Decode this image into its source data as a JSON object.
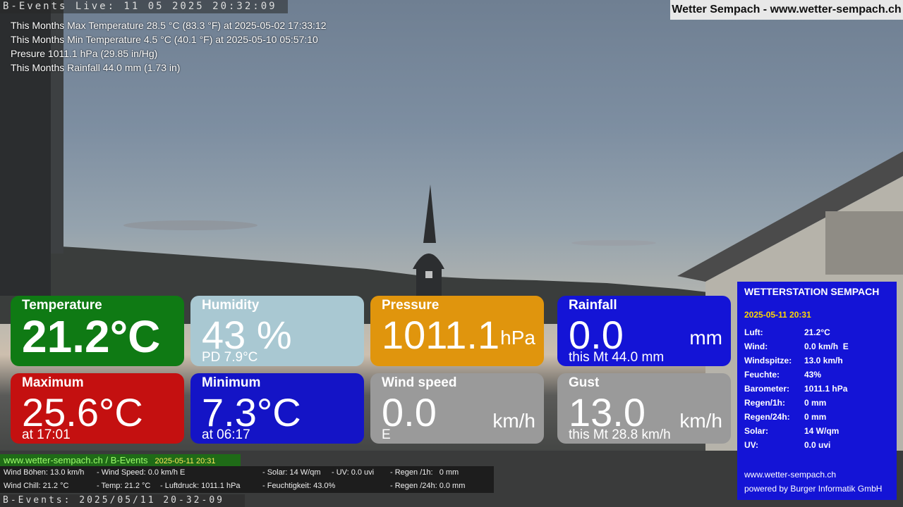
{
  "camera": {
    "title": "B-Events Live: 11 05 2025 20:32:09",
    "footer": "B-Events: 2025/05/11 20-32-09"
  },
  "brand": "Wetter Sempach - www.wetter-sempach.ch",
  "stats": [
    "This Months Max Temperature 28.5 °C (83.3 °F) at 2025-05-02 17:33:12",
    "This Months Min Temperature 4.5 °C (40.1 °F) at 2025-05-10 05:57:10",
    "Presure 1011.1 hPa (29.85 in/Hg)",
    "This Months Rainfall 44.0 mm (1.73 in)"
  ],
  "tiles": {
    "temperature": {
      "label": "Temperature",
      "value": "21.2°C",
      "color": "#0f7a14"
    },
    "humidity": {
      "label": "Humidity",
      "value": "43 %",
      "sub": "PD 7.9°C",
      "color": "#a9c8d2"
    },
    "pressure": {
      "label": "Pressure",
      "value": "1011.1",
      "unit": "hPa",
      "color": "#e0950d"
    },
    "rainfall": {
      "label": "Rainfall",
      "value": "0.0",
      "unit": "mm",
      "sub": "this Mt 44.0 mm",
      "color": "#1414d6"
    },
    "maximum": {
      "label": "Maximum",
      "value": "25.6°C",
      "sub": "at 17:01",
      "color": "#c41010"
    },
    "minimum": {
      "label": "Minimum",
      "value": "7.3°C",
      "sub": "at 06:17",
      "color": "#1414c6"
    },
    "wind": {
      "label": "Wind speed",
      "value": "0.0",
      "unit": "km/h",
      "sub": "E",
      "color": "#9a9a9a"
    },
    "gust": {
      "label": "Gust",
      "value": "13.0",
      "unit": "km/h",
      "sub": "this Mt 28.8 km/h",
      "color": "#9a9a9a"
    }
  },
  "station": {
    "title": "WETTERSTATION SEMPACH",
    "date": "2025-05-11 20:31",
    "rows": [
      {
        "k": "Luft:",
        "v": "21.2°C"
      },
      {
        "k": "Wind:",
        "v": "0.0 km/h  E"
      },
      {
        "k": "Windspitze:",
        "v": "13.0 km/h"
      },
      {
        "k": "Feuchte:",
        "v": "43%"
      },
      {
        "k": "Barometer:",
        "v": "1011.1 hPa"
      },
      {
        "k": "Regen/1h:",
        "v": "0 mm"
      },
      {
        "k": "Regen/24h:",
        "v": "0 mm"
      },
      {
        "k": "Solar:",
        "v": "14 W/qm"
      },
      {
        "k": "UV:",
        "v": "0.0 uvi"
      }
    ],
    "site": "www.wetter-sempach.ch",
    "powered": "powered by Burger Informatik GmbH"
  },
  "sitebar": {
    "text": "www.wetter-sempach.ch / B-Events",
    "date": "2025-05-11 20:31"
  },
  "ticker": {
    "r1c1": "Wind Böhen: 13.0 km/h",
    "r1c2": "- Wind Speed: 0.0 km/h E",
    "r1c3": "- Solar: 14 W/qm",
    "r1c4": "- UV: 0.0 uvi",
    "r1c5": "- Regen /1h:   0 mm",
    "r2c1": "Wind Chill: 21.2 °C",
    "r2c2": "- Temp: 21.2 °C",
    "r2c3": "- Luftdruck: 1011.1 hPa",
    "r2c4": "- Feuchtigkeit: 43.0%",
    "r2c5": "- Regen /24h: 0.0 mm"
  }
}
